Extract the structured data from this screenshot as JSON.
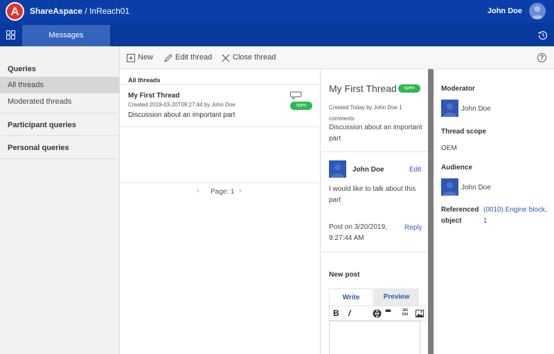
{
  "header": {
    "brand_name": "ShareAspace",
    "brand_sep": " / ",
    "brand_space": "InReach01",
    "logo_letter": "A",
    "user_name": "John Doe"
  },
  "nav": {
    "tab_messages": "Messages"
  },
  "sidebar": {
    "queries_heading": "Queries",
    "items": [
      {
        "label": "All threads",
        "active": true
      },
      {
        "label": "Moderated threads",
        "active": false
      }
    ],
    "participant_heading": "Participant queries",
    "personal_heading": "Personal queries"
  },
  "toolbar": {
    "new_label": "New",
    "edit_label": "Edit thread",
    "close_label": "Close thread",
    "help_glyph": "?"
  },
  "thread_list": {
    "title": "All threads",
    "threads": [
      {
        "title": "My First Thread",
        "meta": "Created 2019-03-20T09:27:44 by John Doe",
        "description": "Discussion about an important part",
        "status": "open"
      }
    ],
    "pager_label": "Page: 1",
    "pager_prev": "‹",
    "pager_next": "›"
  },
  "detail": {
    "title": "My First Thread",
    "status": "open",
    "meta": "Created Today by John Doe 1 comments",
    "description": "Discussion about an important part",
    "post": {
      "author": "John Doe",
      "edit_label": "Edit",
      "text": "I would like to talk about this part",
      "date": "Post on 3/20/2019, 9:27:44 AM",
      "reply_label": "Reply"
    },
    "new_post_label": "New post",
    "write_tab": "Write",
    "preview_tab": "Preview",
    "editor_buttons": {
      "bold": "B",
      "italic": "/",
      "quote": "❝❝",
      "code": "101 010"
    }
  },
  "info": {
    "moderator_label": "Moderator",
    "moderator_name": "John Doe",
    "scope_label": "Thread scope",
    "scope_value": "OEM",
    "audience_label": "Audience",
    "audience_name": "John Doe",
    "referenced_label": "Referenced object",
    "referenced_value": "(0010) Engine block, 1"
  },
  "colors": {
    "topbar": "#0a3ea8",
    "navbar": "#083a9e",
    "active_tab": "#3564bd",
    "status_open": "#2eb84d",
    "link": "#2f58b4",
    "logo": "#e4322b"
  }
}
